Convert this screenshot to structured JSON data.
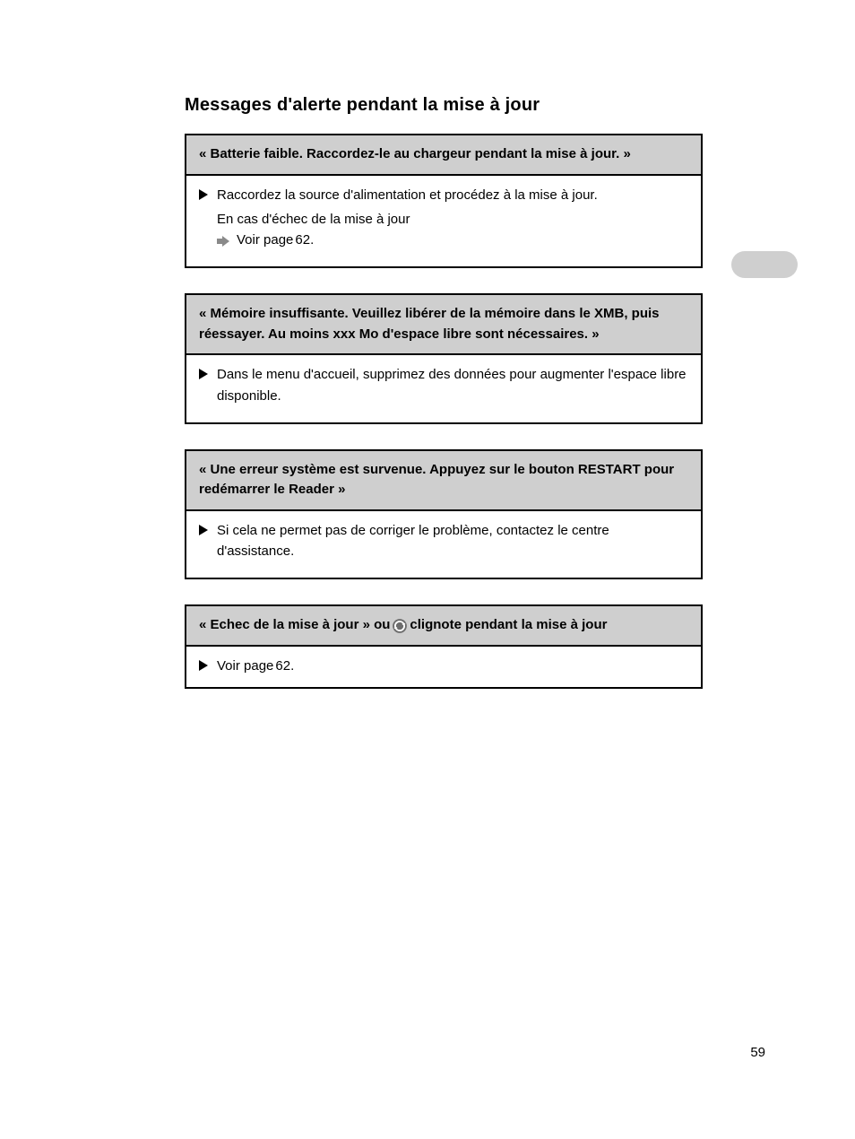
{
  "title": "Messages d'alerte pendant la mise à jour",
  "page_number": "59",
  "boxes": [
    {
      "header": "« Batterie faible. Raccordez-le au chargeur pendant la mise à jour. »",
      "rows": [
        {
          "icon": "tri",
          "text": "Raccordez la source d'alimentation et procédez à la mise à jour."
        },
        {
          "icon": "none",
          "text": "En cas d'échec de la mise à jour"
        },
        {
          "icon": "arrow",
          "text": "Voir page "
        },
        {
          "icon": "none_inline",
          "text": "62"
        },
        {
          "icon": "none_inline",
          "text": "."
        }
      ]
    },
    {
      "header": "« Mémoire insuffisante. Veuillez libérer de la mémoire dans le XMB, puis réessayer. Au moins xxx Mo d'espace libre sont nécessaires. »",
      "rows": [
        {
          "icon": "tri",
          "text": "Dans le menu d'accueil, supprimez des données pour augmenter l'espace libre disponible."
        }
      ]
    },
    {
      "header": "« Une erreur système est survenue. Appuyez sur le bouton RESTART pour redémarrer le Reader »",
      "rows": [
        {
          "icon": "tri",
          "text": "Si cela ne permet pas de corriger le problème, contactez le centre d'assistance."
        }
      ]
    },
    {
      "header_pre": "« Echec de la mise à jour » ou    ",
      "header_post": " clignote pendant la mise à jour",
      "rows": [
        {
          "icon": "tri",
          "text": "Voir page "
        },
        {
          "icon": "none_inline",
          "text": "62"
        },
        {
          "icon": "none_inline",
          "text": "."
        }
      ]
    }
  ]
}
